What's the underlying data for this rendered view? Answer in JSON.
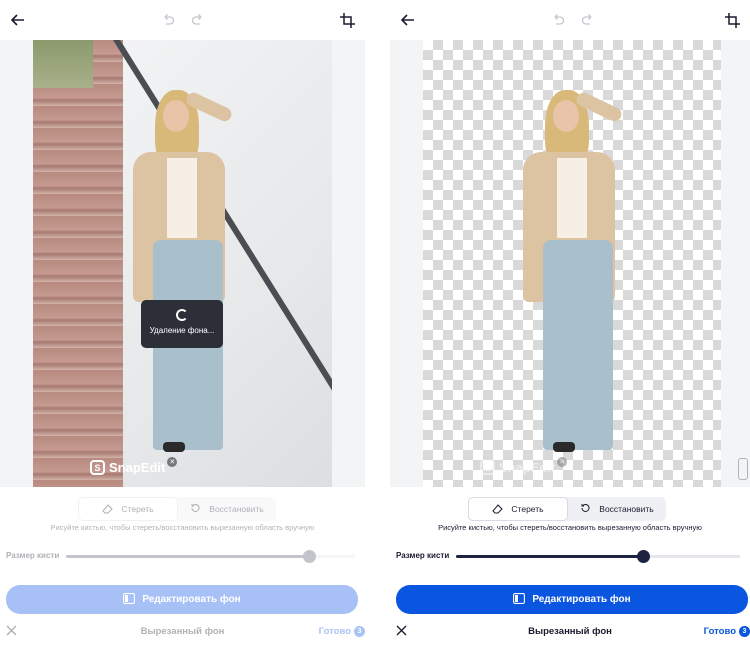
{
  "colors": {
    "accent": "#0a56e0",
    "accent_disabled": "#b9cdf5",
    "text_dark": "#1a1a2e",
    "loader_bg": "#2d2f38",
    "knob": "#1d2340"
  },
  "left": {
    "toolbar": {
      "back_icon": "arrow-left-icon",
      "undo_icon": "undo-icon",
      "redo_icon": "redo-icon",
      "crop_icon": "crop-icon"
    },
    "loader": {
      "text": "Удаление фона..."
    },
    "watermark": {
      "text": "SnapEdit"
    },
    "segment": {
      "erase_label": "Стереть",
      "restore_label": "Восстановить"
    },
    "hint": "Рисуйте кистью, чтобы стереть/восстановить вырезанную область вручную",
    "brush": {
      "label": "Размер кисти",
      "value_fraction": 0.84
    },
    "primary_label": "Редактировать фон",
    "bottom": {
      "title": "Вырезанный фон",
      "done_label": "Готово",
      "done_count": "3"
    }
  },
  "right": {
    "toolbar": {
      "back_icon": "arrow-left-icon",
      "undo_icon": "undo-icon",
      "redo_icon": "redo-icon",
      "crop_icon": "crop-icon"
    },
    "watermark": {
      "text": "SnapEdit"
    },
    "segment": {
      "erase_label": "Стереть",
      "restore_label": "Восстановить"
    },
    "hint": "Рисуйте кистью, чтобы стереть/восстановить вырезанную область вручную",
    "brush": {
      "label": "Размер кисти",
      "value_fraction": 0.66
    },
    "primary_label": "Редактировать фон",
    "bottom": {
      "title": "Вырезанный фон",
      "done_label": "Готово",
      "done_count": "3"
    }
  }
}
